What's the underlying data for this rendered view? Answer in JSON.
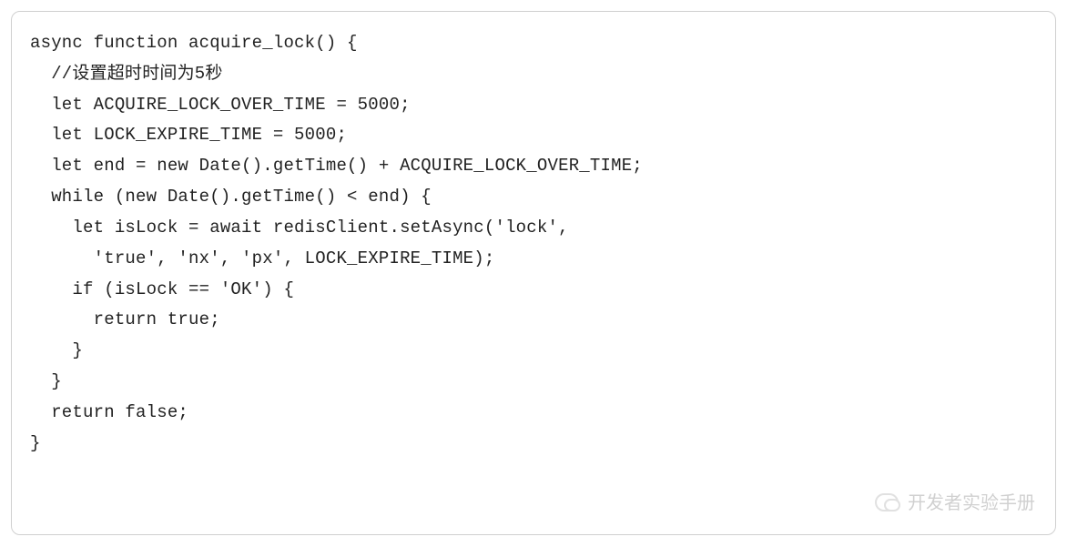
{
  "code": {
    "lines": [
      "async function acquire_lock() {",
      "  //设置超时时间为5秒",
      "  let ACQUIRE_LOCK_OVER_TIME = 5000;",
      "  let LOCK_EXPIRE_TIME = 5000;",
      "  let end = new Date().getTime() + ACQUIRE_LOCK_OVER_TIME;",
      "  while (new Date().getTime() < end) {",
      "    let isLock = await redisClient.setAsync('lock',",
      "      'true', 'nx', 'px', LOCK_EXPIRE_TIME);",
      "    if (isLock == 'OK') {",
      "      return true;",
      "    }",
      "  }",
      "  return false;",
      "}"
    ]
  },
  "watermark": {
    "text": "开发者实验手册"
  }
}
